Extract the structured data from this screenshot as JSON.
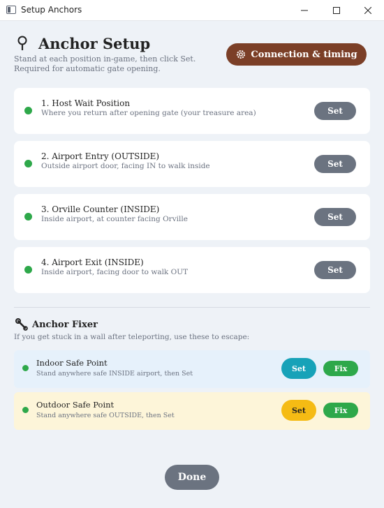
{
  "window": {
    "title": "Setup Anchors"
  },
  "header": {
    "title": "Anchor Setup",
    "subtitle_line1": "Stand at each position in-game, then click Set.",
    "subtitle_line2": "Required for automatic gate opening."
  },
  "connection_button": {
    "label": "Connection & timing",
    "icon": "gear-icon"
  },
  "anchors": [
    {
      "title": "1. Host Wait Position",
      "description": "Where you return after opening gate (your treasure area)",
      "button": "Set",
      "status": "green"
    },
    {
      "title": "2. Airport Entry (OUTSIDE)",
      "description": "Outside airport door, facing IN to walk inside",
      "button": "Set",
      "status": "green"
    },
    {
      "title": "3. Orville Counter (INSIDE)",
      "description": "Inside airport, at counter facing Orville",
      "button": "Set",
      "status": "green"
    },
    {
      "title": "4. Airport Exit (INSIDE)",
      "description": "Inside airport, facing door to walk OUT",
      "button": "Set",
      "status": "green"
    }
  ],
  "fixer": {
    "title": "Anchor Fixer",
    "icon": "wrench-icon",
    "subtitle": "If you get stuck in a wall after teleporting, use these to escape:",
    "items": [
      {
        "title": "Indoor Safe Point",
        "description": "Stand anywhere safe INSIDE airport, then Set",
        "set": "Set",
        "fix": "Fix"
      },
      {
        "title": "Outdoor Safe Point",
        "description": "Stand anywhere safe OUTSIDE, then Set",
        "set": "Set",
        "fix": "Fix"
      }
    ]
  },
  "footer": {
    "done": "Done"
  },
  "colors": {
    "connection_button": "#7b3f27",
    "status_green": "#2ea84a",
    "set_button": "#6b7380",
    "indoor_set": "#17a2b8",
    "outdoor_set": "#f5bb14",
    "indoor_bg": "#e6f1fb",
    "outdoor_bg": "#fdf5d9"
  }
}
